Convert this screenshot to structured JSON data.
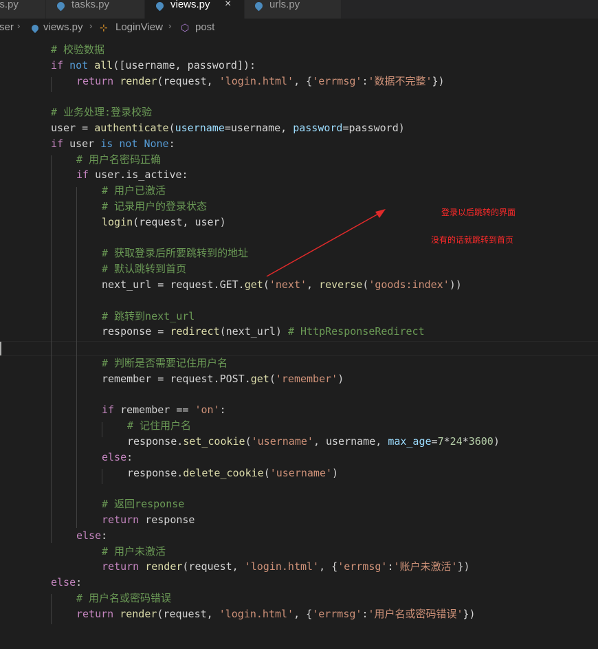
{
  "tabs": [
    {
      "label": "gs.py",
      "active": false,
      "icon": "python-file-icon"
    },
    {
      "label": "tasks.py",
      "active": false,
      "icon": "python-file-icon"
    },
    {
      "label": "views.py",
      "active": true,
      "icon": "python-file-icon",
      "close": "×"
    },
    {
      "label": "urls.py",
      "active": false,
      "icon": "python-file-icon"
    }
  ],
  "breadcrumb": {
    "items": [
      "ser",
      "views.py",
      "LoginView",
      "post"
    ],
    "separator": "›"
  },
  "code_lines": [
    {
      "tokens": [
        [
          "cm",
          "# 校验数据"
        ]
      ]
    },
    {
      "tokens": [
        [
          "ctl",
          "if "
        ],
        [
          "kw",
          "not "
        ],
        [
          "fn",
          "all"
        ],
        [
          "plain",
          "([username, password]):"
        ]
      ]
    },
    {
      "tokens": [
        [
          "ctl",
          "return "
        ],
        [
          "fn",
          "render"
        ],
        [
          "plain",
          "(request, "
        ],
        [
          "str",
          "'login.html'"
        ],
        [
          "plain",
          ", {"
        ],
        [
          "str",
          "'errmsg'"
        ],
        [
          "plain",
          ":"
        ],
        [
          "str",
          "'数据不完整'"
        ],
        [
          "plain",
          "})"
        ]
      ]
    },
    {
      "tokens": []
    },
    {
      "tokens": [
        [
          "cm",
          "# 业务处理:登录校验"
        ]
      ]
    },
    {
      "tokens": [
        [
          "plain",
          "user = "
        ],
        [
          "fn",
          "authenticate"
        ],
        [
          "plain",
          "("
        ],
        [
          "var",
          "username"
        ],
        [
          "plain",
          "=username, "
        ],
        [
          "var",
          "password"
        ],
        [
          "plain",
          "=password)"
        ]
      ]
    },
    {
      "tokens": [
        [
          "ctl",
          "if "
        ],
        [
          "plain",
          "user "
        ],
        [
          "kw",
          "is not None"
        ],
        [
          "plain",
          ":"
        ]
      ]
    },
    {
      "tokens": [
        [
          "cm",
          "# 用户名密码正确"
        ]
      ]
    },
    {
      "tokens": [
        [
          "ctl",
          "if "
        ],
        [
          "plain",
          "user.is_active:"
        ]
      ]
    },
    {
      "tokens": [
        [
          "cm",
          "# 用户已激活"
        ]
      ]
    },
    {
      "tokens": [
        [
          "cm",
          "# 记录用户的登录状态"
        ]
      ]
    },
    {
      "tokens": [
        [
          "fn",
          "login"
        ],
        [
          "plain",
          "(request, user)"
        ]
      ]
    },
    {
      "tokens": []
    },
    {
      "tokens": [
        [
          "cm",
          "# 获取登录后所要跳转到的地址"
        ]
      ]
    },
    {
      "tokens": [
        [
          "cm",
          "# 默认跳转到首页"
        ]
      ]
    },
    {
      "tokens": [
        [
          "plain",
          "next_url = request.GET."
        ],
        [
          "fn",
          "get"
        ],
        [
          "plain",
          "("
        ],
        [
          "str",
          "'next'"
        ],
        [
          "plain",
          ", "
        ],
        [
          "fn",
          "reverse"
        ],
        [
          "plain",
          "("
        ],
        [
          "str",
          "'goods:index'"
        ],
        [
          "plain",
          "))"
        ]
      ]
    },
    {
      "tokens": []
    },
    {
      "tokens": [
        [
          "cm",
          "# 跳转到next_url"
        ]
      ]
    },
    {
      "tokens": [
        [
          "plain",
          "response = "
        ],
        [
          "fn",
          "redirect"
        ],
        [
          "plain",
          "(next_url) "
        ],
        [
          "cm",
          "# HttpResponseRedirect"
        ]
      ]
    },
    {
      "tokens": []
    },
    {
      "tokens": [
        [
          "cm",
          "# 判断是否需要记住用户名"
        ]
      ]
    },
    {
      "tokens": [
        [
          "plain",
          "remember = request.POST."
        ],
        [
          "fn",
          "get"
        ],
        [
          "plain",
          "("
        ],
        [
          "str",
          "'remember'"
        ],
        [
          "plain",
          ")"
        ]
      ]
    },
    {
      "tokens": []
    },
    {
      "tokens": [
        [
          "ctl",
          "if "
        ],
        [
          "plain",
          "remember == "
        ],
        [
          "str",
          "'on'"
        ],
        [
          "plain",
          ":"
        ]
      ]
    },
    {
      "tokens": [
        [
          "cm",
          "# 记住用户名"
        ]
      ]
    },
    {
      "tokens": [
        [
          "plain",
          "response."
        ],
        [
          "fn",
          "set_cookie"
        ],
        [
          "plain",
          "("
        ],
        [
          "str",
          "'username'"
        ],
        [
          "plain",
          ", username, "
        ],
        [
          "var",
          "max_age"
        ],
        [
          "plain",
          "="
        ],
        [
          "num",
          "7"
        ],
        [
          "plain",
          "*"
        ],
        [
          "num",
          "24"
        ],
        [
          "plain",
          "*"
        ],
        [
          "num",
          "3600"
        ],
        [
          "plain",
          ")"
        ]
      ]
    },
    {
      "tokens": [
        [
          "ctl",
          "else"
        ],
        [
          "plain",
          ":"
        ]
      ]
    },
    {
      "tokens": [
        [
          "plain",
          "response."
        ],
        [
          "fn",
          "delete_cookie"
        ],
        [
          "plain",
          "("
        ],
        [
          "str",
          "'username'"
        ],
        [
          "plain",
          ")"
        ]
      ]
    },
    {
      "tokens": []
    },
    {
      "tokens": [
        [
          "cm",
          "# 返回response"
        ]
      ]
    },
    {
      "tokens": [
        [
          "ctl",
          "return "
        ],
        [
          "plain",
          "response"
        ]
      ]
    },
    {
      "tokens": [
        [
          "ctl",
          "else"
        ],
        [
          "plain",
          ":"
        ]
      ]
    },
    {
      "tokens": [
        [
          "cm",
          "# 用户未激活"
        ]
      ]
    },
    {
      "tokens": [
        [
          "ctl",
          "return "
        ],
        [
          "fn",
          "render"
        ],
        [
          "plain",
          "(request, "
        ],
        [
          "str",
          "'login.html'"
        ],
        [
          "plain",
          ", {"
        ],
        [
          "str",
          "'errmsg'"
        ],
        [
          "plain",
          ":"
        ],
        [
          "str",
          "'账户未激活'"
        ],
        [
          "plain",
          "})"
        ]
      ]
    },
    {
      "tokens": [
        [
          "ctl",
          "else"
        ],
        [
          "plain",
          ":"
        ]
      ]
    },
    {
      "tokens": [
        [
          "cm",
          "# 用户名或密码错误"
        ]
      ]
    },
    {
      "tokens": [
        [
          "ctl",
          "return "
        ],
        [
          "fn",
          "render"
        ],
        [
          "plain",
          "(request, "
        ],
        [
          "str",
          "'login.html'"
        ],
        [
          "plain",
          ", {"
        ],
        [
          "str",
          "'errmsg'"
        ],
        [
          "plain",
          ":"
        ],
        [
          "str",
          "'用户名或密码错误'"
        ],
        [
          "plain",
          "})"
        ]
      ]
    }
  ],
  "annotations": [
    {
      "text": "登录以后跳转的界面"
    },
    {
      "text": "没有的话就跳转到首页"
    }
  ],
  "colors": {
    "background": "#1e1e1e",
    "comment": "#6a9955",
    "keyword": "#569cd6",
    "control": "#c586c0",
    "function": "#dcdcaa",
    "string": "#ce9178",
    "variable": "#9cdcfe",
    "annotation": "#ff2a2a"
  }
}
